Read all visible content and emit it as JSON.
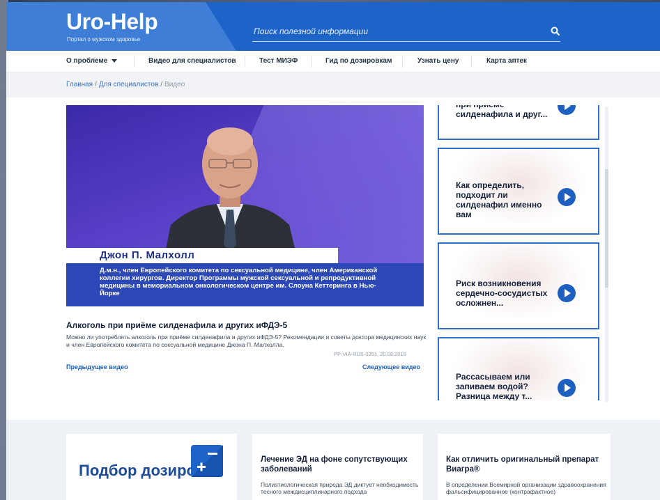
{
  "header": {
    "logo": "Uro-Help",
    "tagline": "Портал о мужском здоровье",
    "search_placeholder": "Поиск полезной информации"
  },
  "nav": {
    "items": [
      {
        "label": "О проблеме",
        "has_dropdown": true
      },
      {
        "label": "Видео для специалистов"
      },
      {
        "label": "Тест МИЭФ"
      },
      {
        "label": "Гид по дозировкам"
      },
      {
        "label": "Узнать цену"
      },
      {
        "label": "Карта аптек"
      }
    ]
  },
  "breadcrumb": {
    "home": "Главная",
    "section": "Для специалистов",
    "current": "Видео"
  },
  "video": {
    "speaker_name": "Джон П. Малхолл",
    "speaker_caption": "Д.м.н., член Европейского комитета по сексуальной медицине, член Американской коллегии хирургов. Директор Программы мужской сексуальной и репродуктивной медицины в мемориальном онкологическом центре им. Слоуна Кеттеринга в Нью-Йорке",
    "title": "Алкоголь при приёме силденафила и других иФДЭ-5",
    "description": "Можно ли употреблять алкоголь при приёме силденафила и других иФДЭ-5? Рекомендации и советы доктора медицинских наук и член Европейского комитета по сексуальной медицине Джона П. Малхолла.",
    "code": "PP-VIA-RUS-0251, 20.08.2019",
    "prev_label": "Предыдущее видео",
    "next_label": "Следующее видео"
  },
  "playlist": [
    {
      "title": "при приёме силденафила и друг..."
    },
    {
      "title": "Как определить, подходит ли силденафил именно вам"
    },
    {
      "title": "Риск возникновения сердечно-сосудистых осложнен..."
    },
    {
      "title": "Рассасываем или запиваем водой? Разница между т..."
    }
  ],
  "bottom_cards": {
    "dose_title": "Подбор дозировки",
    "card2_title": "Лечение ЭД на фоне сопутствующих заболеваний",
    "card2_text": "Полиэтиологическая природа ЭД диктует необходимость тесного междисциплинарного подхода",
    "card3_title": "Как отличить оригинальный препарат Виагра®",
    "card3_text": "В определении Всемирной организации здравоохранения фальсифицированное (контрафактное)"
  },
  "colors": {
    "brand_blue": "#1e64c8",
    "link_blue": "#1e5fc2",
    "video_purple": "#5a3fc8"
  }
}
